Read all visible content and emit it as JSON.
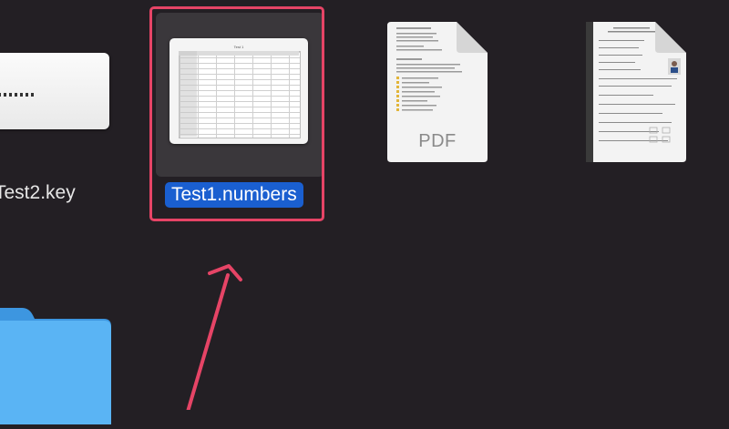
{
  "files": [
    {
      "name": "Test2.key",
      "kind": "keynote"
    },
    {
      "name": "Test1.numbers",
      "kind": "numbers",
      "selected": true
    },
    {
      "name": "",
      "kind": "pdf",
      "badge": "PDF"
    },
    {
      "name": "",
      "kind": "pdf-form"
    }
  ],
  "numbers_preview": {
    "sheet_title": "Test 1"
  },
  "colors": {
    "desktop_bg": "#231f24",
    "selection_label": "#1a5fd0",
    "callout": "#e64466",
    "folder": "#4aa8f0"
  }
}
